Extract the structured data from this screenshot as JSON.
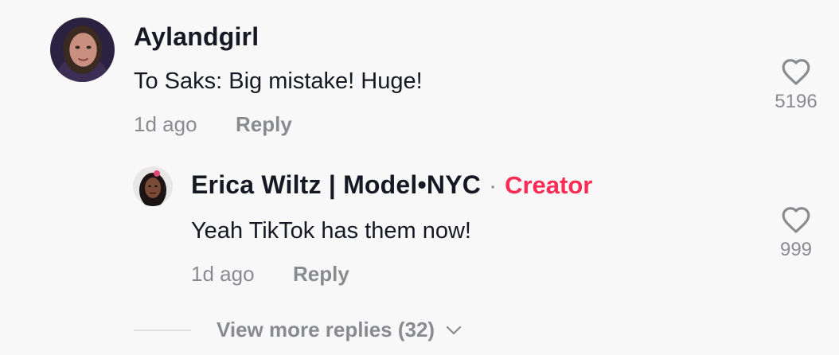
{
  "colors": {
    "background": "#f8f8f8",
    "text_primary": "#161823",
    "text_secondary": "#8a8b91",
    "creator_accent": "#fe2c55"
  },
  "comment": {
    "username": "Aylandgirl",
    "text": "To Saks: Big mistake! Huge!",
    "time": "1d ago",
    "reply_label": "Reply",
    "likes": "5196",
    "avatar_icon": "user-avatar-photo",
    "like_icon": "heart-outline-icon"
  },
  "reply": {
    "username": "Erica Wiltz | Model•NYC",
    "separator": "·",
    "badge": "Creator",
    "text": "Yeah TikTok has them now!",
    "time": "1d ago",
    "reply_label": "Reply",
    "likes": "999",
    "avatar_icon": "user-avatar-photo",
    "like_icon": "heart-outline-icon"
  },
  "view_more": {
    "label": "View more replies (32)",
    "icon": "chevron-down-icon"
  }
}
